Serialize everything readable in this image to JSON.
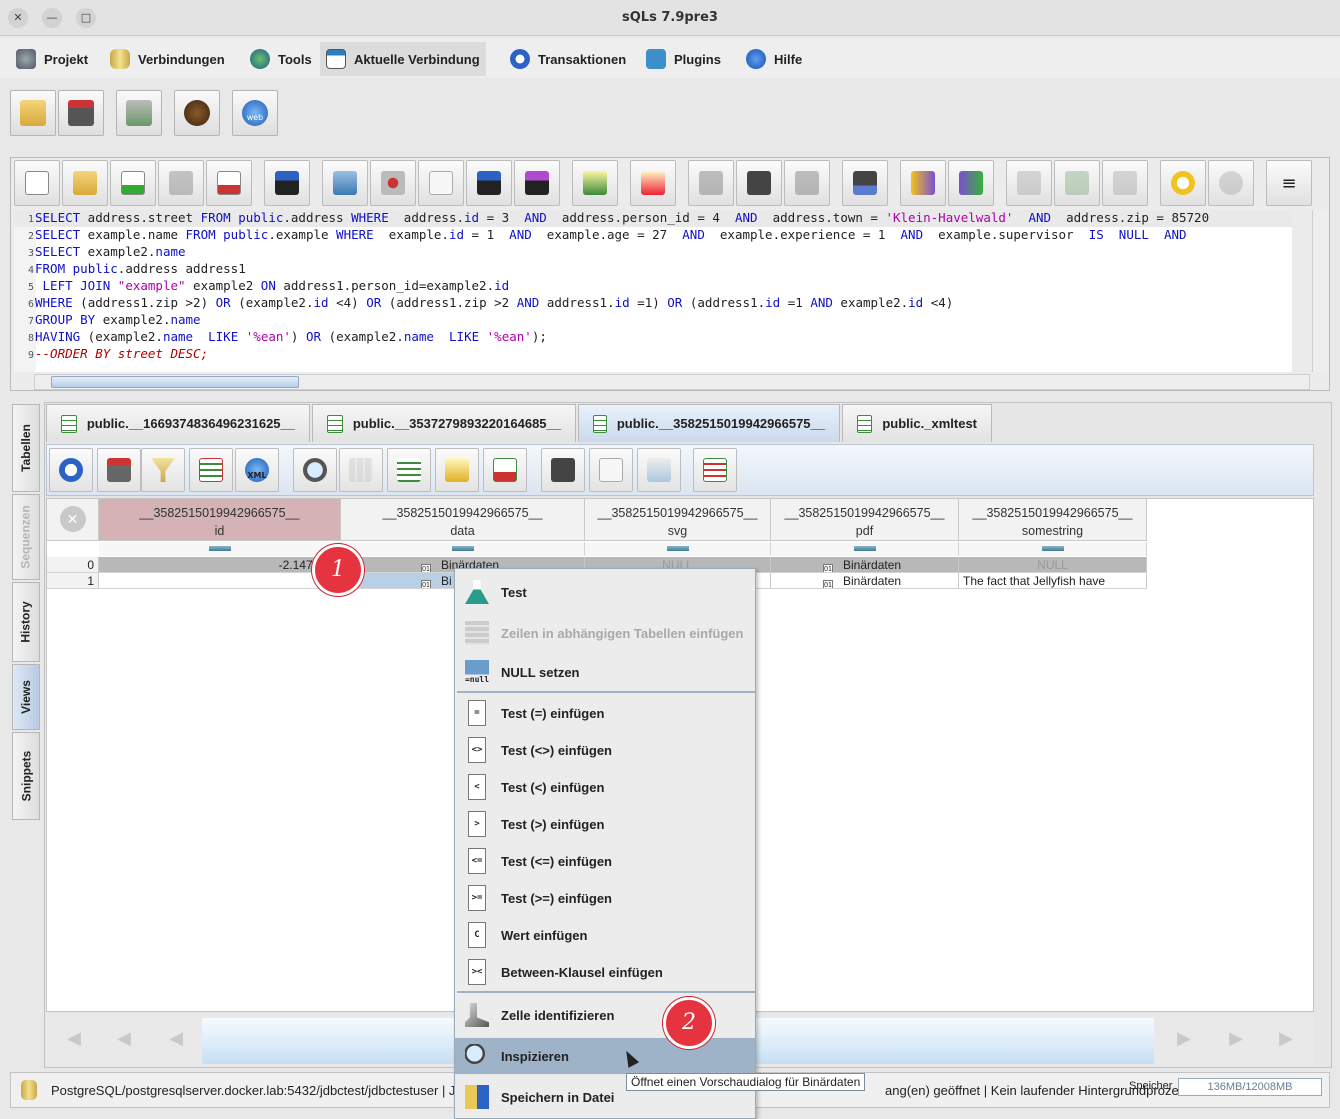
{
  "window": {
    "title": "sQLs 7.9pre3",
    "close": "✕",
    "minimize": "—",
    "maximize": "□"
  },
  "menu": [
    {
      "label": "Projekt",
      "icon": "gears-icon"
    },
    {
      "label": "Verbindungen",
      "icon": "database-icon"
    },
    {
      "label": "Tools",
      "icon": "globe-icon"
    },
    {
      "label": "Aktuelle Verbindung",
      "icon": "window-icon"
    },
    {
      "label": "Transaktionen",
      "icon": "refresh-g-icon"
    },
    {
      "label": "Plugins",
      "icon": "puzzle-icon"
    },
    {
      "label": "Hilfe",
      "icon": "info-icon"
    }
  ],
  "main_toolbar": {
    "web_label": "web"
  },
  "editor": {
    "lines": [
      "1",
      "2",
      "3",
      "4",
      "5",
      "6",
      "7",
      "8",
      "9"
    ]
  },
  "sidetabs": {
    "tabellen": "Tabellen",
    "sequenzen": "Sequenzen",
    "history": "History",
    "views": "Views",
    "snippets": "Snippets"
  },
  "result_tabs": [
    "public.__1669374836496231625__",
    "public.__3537279893220164685__",
    "public.__3582515019942966575__",
    "public._xmltest"
  ],
  "results_toolbar": {
    "xml_label": "XML"
  },
  "grid": {
    "prefix": "__3582515019942966575__",
    "columns": [
      "id",
      "data",
      "svg",
      "pdf",
      "somestring"
    ],
    "rows": [
      {
        "num": "0",
        "id": "-2.147.483",
        "data": "Binärdaten",
        "svg": "NULL",
        "pdf": "Binärdaten",
        "somestring": "NULL"
      },
      {
        "num": "1",
        "id": "",
        "data": "Bi",
        "svg": "",
        "pdf": "Binärdaten",
        "somestring": "The fact that Jellyfish have"
      }
    ],
    "bin_icon_label": "01"
  },
  "context_menu": {
    "test": "Test",
    "insert_dependent": "Zeilen in abhängigen Tabellen einfügen",
    "set_null": "NULL setzen",
    "null_icon_label": "=null",
    "ops": [
      {
        "sym": "=",
        "label": "Test (=) einfügen"
      },
      {
        "sym": "<>",
        "label": "Test (<>) einfügen"
      },
      {
        "sym": "<",
        "label": "Test (<) einfügen"
      },
      {
        "sym": ">",
        "label": "Test (>) einfügen"
      },
      {
        "sym": "<=",
        "label": "Test (<=) einfügen"
      },
      {
        "sym": ">=",
        "label": "Test (>=) einfügen"
      },
      {
        "sym": "C",
        "label": "Wert einfügen"
      },
      {
        "sym": "><",
        "label": "Between-Klausel einfügen"
      }
    ],
    "identify": "Zelle identifizieren",
    "inspect": "Inspizieren",
    "save_file": "Speichern in Datei"
  },
  "tooltip": "Öffnet einen Vorschaudialog für Binärdaten",
  "status": {
    "connection": "PostgreSQL/postgresqlserver.docker.lab:5432/jdbctest/jdbctestuser | JM",
    "background": "ang(en) geöffnet | Kein laufender Hintergrundprozeß.",
    "memory_label": "Speicher",
    "memory_value": "136MB/12008MB"
  },
  "markers": [
    "1",
    "2"
  ]
}
